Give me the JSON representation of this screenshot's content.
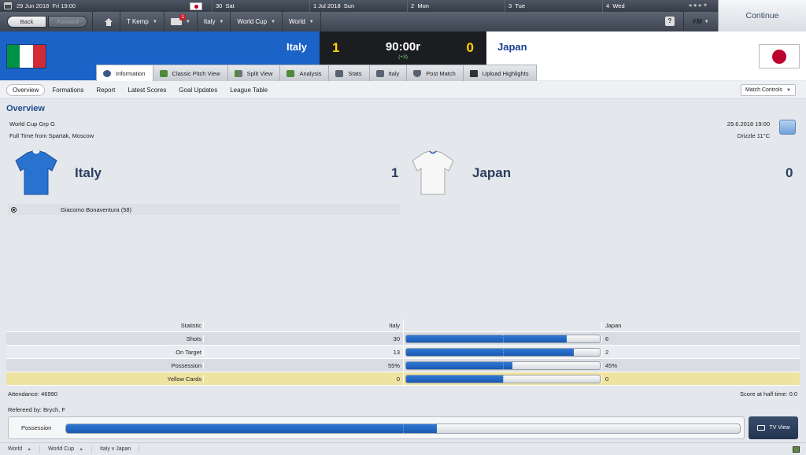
{
  "topbar": {
    "date": "29 Jun 2018",
    "weekday_time": "Fri 19:00",
    "days": [
      {
        "num": "30",
        "label": "Sat"
      },
      {
        "num": "1 Jul 2018",
        "label": "Sun"
      },
      {
        "num": "2",
        "label": "Mon"
      },
      {
        "num": "3",
        "label": "Tue"
      },
      {
        "num": "4",
        "label": "Wed"
      }
    ]
  },
  "nav": {
    "back": "Back",
    "forward": "Forward",
    "manager": "T Kemp",
    "inbox_count": "1",
    "items": [
      "Italy",
      "World Cup",
      "World"
    ],
    "help": "?",
    "fm": "FM"
  },
  "continue_label": "Continue",
  "match": {
    "home_team": "Italy",
    "away_team": "Japan",
    "home_score": "1",
    "away_score": "0",
    "time": "90:00r",
    "added": "(+3)"
  },
  "tabs": [
    "Information",
    "Classic Pitch View",
    "Split View",
    "Analysis",
    "Stats",
    "Italy",
    "Post Match",
    "Upload Highlights"
  ],
  "subnav": [
    "Overview",
    "Formations",
    "Report",
    "Latest Scores",
    "Goal Updates",
    "League Table"
  ],
  "match_controls": "Match Controls",
  "overview": {
    "title": "Overview",
    "competition": "World Cup Grp G",
    "venue": "Full Time from Spartak, Moscow",
    "datetime": "29.6.2018 19:00",
    "weather": "Drizzle 11°C",
    "home_name": "Italy",
    "home_goals": "1",
    "away_name": "Japan",
    "away_goals": "0",
    "scorer": "Giacomo Bonaventura (58)"
  },
  "stats": {
    "header": {
      "label": "Statistic",
      "home": "Italy",
      "away": "Japan"
    },
    "rows": [
      {
        "label": "Shots",
        "home": "30",
        "away": "6",
        "home_share": 0.833
      },
      {
        "label": "On Target",
        "home": "13",
        "away": "2",
        "home_share": 0.867
      },
      {
        "label": "Possession",
        "home": "55%",
        "away": "45%",
        "home_share": 0.55
      },
      {
        "label": "Yellow Cards",
        "home": "0",
        "away": "0",
        "home_share": 0.5
      }
    ]
  },
  "attendance": "Attendance: 46990",
  "halftime": "Score at half time: 0:0",
  "referee": "Refereed by: Brych, F",
  "possession": {
    "label": "Possession",
    "home_share": 0.55
  },
  "tv_view": "TV View",
  "statusbar": [
    "World",
    "World Cup",
    "Italy v Japan"
  ],
  "colors": {
    "italy_blue": "#1c63c8",
    "bar_blue": "#1a58b0",
    "score_yellow": "#ffd200",
    "japan_red": "#bc002d"
  }
}
